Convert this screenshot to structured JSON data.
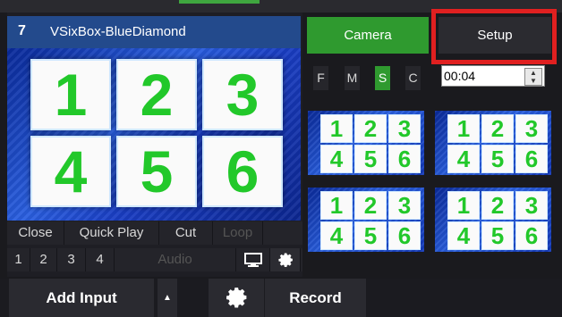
{
  "input": {
    "number": "7",
    "name": "VSixBox-BlueDiamond",
    "preview_tiles": [
      "1",
      "2",
      "3",
      "4",
      "5",
      "6"
    ]
  },
  "controls_row1": {
    "close": "Close",
    "quick_play": "Quick Play",
    "cut": "Cut",
    "loop": "Loop"
  },
  "controls_row2": {
    "slots": [
      "1",
      "2",
      "3",
      "4"
    ],
    "audio": "Audio",
    "icons": [
      "monitor-icon",
      "gear-icon"
    ]
  },
  "right_panel": {
    "camera_label": "Camera",
    "setup_label": "Setup",
    "modes": [
      {
        "label": "F",
        "active": false
      },
      {
        "label": "M",
        "active": false
      },
      {
        "label": "S",
        "active": true
      },
      {
        "label": "C",
        "active": false
      }
    ],
    "time_value": "00:04",
    "thumbnails": [
      [
        "1",
        "2",
        "3",
        "4",
        "5",
        "6"
      ],
      [
        "1",
        "2",
        "3",
        "4",
        "5",
        "6"
      ],
      [
        "1",
        "2",
        "3",
        "4",
        "5",
        "6"
      ],
      [
        "1",
        "2",
        "3",
        "4",
        "5",
        "6"
      ]
    ]
  },
  "bottom_bar": {
    "add_input_label": "Add Input",
    "record_label": "Record"
  },
  "colors": {
    "active_green": "#2f9a2f",
    "highlight_red": "#e02020",
    "title_blue": "#234a8c",
    "tile_digit_green": "#22c82a"
  }
}
